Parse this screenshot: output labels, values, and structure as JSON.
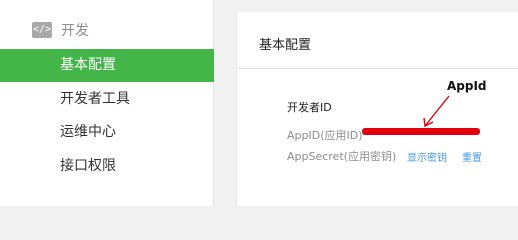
{
  "sidebar": {
    "section": {
      "icon": "code-icon",
      "icon_glyph": "</>",
      "label": "开发"
    },
    "items": [
      {
        "label": "基本配置",
        "active": true
      },
      {
        "label": "开发者工具",
        "active": false
      },
      {
        "label": "运维中心",
        "active": false
      },
      {
        "label": "接口权限",
        "active": false
      }
    ]
  },
  "panel": {
    "title": "基本配置",
    "section_label": "开发者ID",
    "fields": [
      {
        "label": "AppID(应用ID)"
      },
      {
        "label": "AppSecret(应用密钥)",
        "actions": [
          "显示密钥",
          "重置"
        ]
      }
    ]
  },
  "annotation": {
    "text": "AppId",
    "color": "#e3000e"
  },
  "colors": {
    "accent": "#44b549",
    "link": "#459ae9",
    "redaction": "#e3000e"
  }
}
